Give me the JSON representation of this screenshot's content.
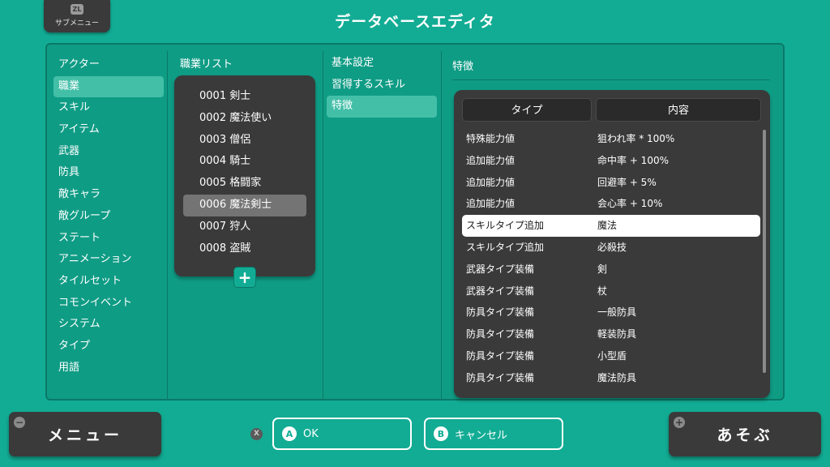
{
  "submenu": {
    "badge": "ZL",
    "label": "サブメニュー"
  },
  "title": "データベースエディタ",
  "categories": {
    "header": "アクター",
    "items": [
      "職業",
      "スキル",
      "アイテム",
      "武器",
      "防具",
      "敵キャラ",
      "敵グループ",
      "ステート",
      "アニメーション",
      "タイルセット",
      "コモンイベント",
      "システム",
      "タイプ",
      "用語"
    ],
    "selected": "職業"
  },
  "class_list": {
    "title": "職業リスト",
    "items": [
      "0001 剣士",
      "0002 魔法使い",
      "0003 僧侶",
      "0004 騎士",
      "0005 格闘家",
      "0006 魔法剣士",
      "0007 狩人",
      "0008 盗賊"
    ],
    "selected": "0006 魔法剣士",
    "add_icon": "plus-icon"
  },
  "tabs": {
    "items": [
      "基本設定",
      "習得するスキル",
      "特徴"
    ],
    "selected": "特徴"
  },
  "traits": {
    "title": "特徴",
    "col_type": "タイプ",
    "col_value": "内容",
    "rows": [
      {
        "type": "特殊能力値",
        "value": "狙われ率 * 100%"
      },
      {
        "type": "追加能力値",
        "value": "命中率 + 100%"
      },
      {
        "type": "追加能力値",
        "value": "回避率 + 5%"
      },
      {
        "type": "追加能力値",
        "value": "会心率 + 10%"
      },
      {
        "type": "スキルタイプ追加",
        "value": "魔法"
      },
      {
        "type": "スキルタイプ追加",
        "value": "必殺技"
      },
      {
        "type": "武器タイプ装備",
        "value": "剣"
      },
      {
        "type": "武器タイプ装備",
        "value": "杖"
      },
      {
        "type": "防具タイプ装備",
        "value": "一般防具"
      },
      {
        "type": "防具タイプ装備",
        "value": "軽装防具"
      },
      {
        "type": "防具タイプ装備",
        "value": "小型盾"
      },
      {
        "type": "防具タイプ装備",
        "value": "魔法防具"
      }
    ],
    "selected_index": 4
  },
  "footer": {
    "menu_label": "メニュー",
    "menu_mark": "−",
    "x_mark": "X",
    "ok_letter": "A",
    "ok_label": "OK",
    "cancel_letter": "B",
    "cancel_label": "キャンセル",
    "play_label": "あそぶ",
    "play_mark": "+"
  },
  "colors": {
    "background": "#12ac94",
    "panel": "#0f9c85",
    "dark_box": "#3a3a3a",
    "selected_teal": "#43bfa8",
    "selected_gray": "#747474"
  }
}
